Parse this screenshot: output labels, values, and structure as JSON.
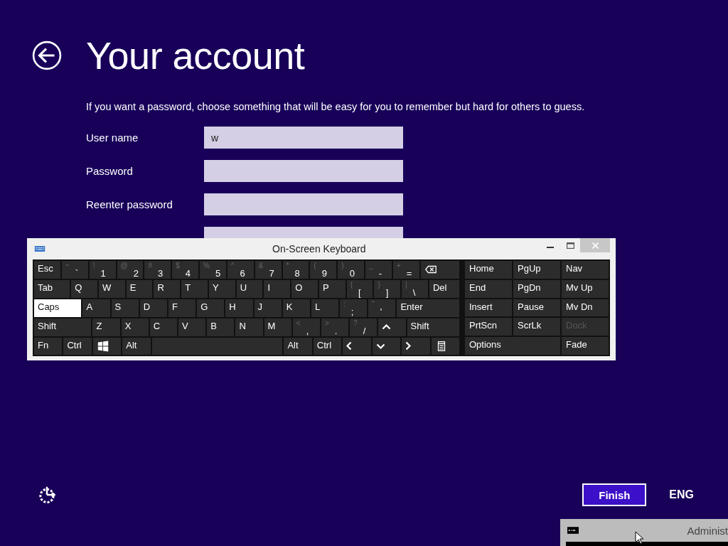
{
  "header": {
    "title": "Your account"
  },
  "intro": "If you want a password, choose something that will be easy for you to remember but hard for others to guess.",
  "fields": [
    {
      "kind": "field",
      "label": "User name",
      "value": "w"
    },
    {
      "kind": "field",
      "label": "Password"
    },
    {
      "kind": "field",
      "label": "Reenter password"
    },
    {
      "kind": "field"
    }
  ],
  "keyboard": {
    "title": "On-Screen Keyboard",
    "rows": [
      {
        "keys": [
          {
            "label": "Esc",
            "kind": "key",
            "on": false
          },
          {
            "label": "`",
            "shift": "~",
            "kind": "key",
            "on": false
          },
          {
            "label": "1",
            "shift": "!",
            "kind": "key",
            "on": false
          },
          {
            "label": "2",
            "shift": "@",
            "kind": "key",
            "on": false
          },
          {
            "label": "3",
            "shift": "#",
            "kind": "key",
            "on": false
          },
          {
            "label": "4",
            "shift": "$",
            "kind": "key",
            "on": false
          },
          {
            "label": "5",
            "shift": "%",
            "kind": "key",
            "on": false
          },
          {
            "label": "6",
            "shift": "^",
            "kind": "key",
            "on": false
          },
          {
            "label": "7",
            "shift": "&",
            "kind": "key",
            "on": false
          },
          {
            "label": "8",
            "shift": "*",
            "kind": "key",
            "on": false
          },
          {
            "label": "9",
            "shift": "(",
            "kind": "key",
            "on": false
          },
          {
            "label": "0",
            "shift": ")",
            "kind": "key",
            "on": false
          },
          {
            "label": "-",
            "shift": "_",
            "kind": "key",
            "on": false
          },
          {
            "label": "=",
            "shift": "+",
            "kind": "key",
            "on": false
          },
          {
            "kind": "backspace",
            "on": false
          }
        ]
      },
      {
        "keys": [
          {
            "label": "Tab",
            "kind": "tab",
            "on": false
          },
          {
            "label": "Q",
            "kind": "key",
            "on": false
          },
          {
            "label": "W",
            "kind": "key",
            "on": false
          },
          {
            "label": "E",
            "kind": "key",
            "on": false
          },
          {
            "label": "R",
            "kind": "key",
            "on": false
          },
          {
            "label": "T",
            "kind": "key",
            "on": false
          },
          {
            "label": "Y",
            "kind": "key",
            "on": false
          },
          {
            "label": "U",
            "kind": "key",
            "on": false
          },
          {
            "label": "I",
            "kind": "key",
            "on": false
          },
          {
            "label": "O",
            "kind": "key",
            "on": false
          },
          {
            "label": "P",
            "kind": "key",
            "on": false
          },
          {
            "label": "[",
            "shift": "{",
            "kind": "key",
            "on": false
          },
          {
            "label": "]",
            "shift": "}",
            "kind": "key",
            "on": false
          },
          {
            "label": "\\",
            "shift": "|",
            "kind": "key",
            "on": false
          },
          {
            "label": "Del",
            "kind": "del",
            "on": false
          }
        ]
      },
      {
        "keys": [
          {
            "label": "Caps",
            "kind": "caps",
            "on": true
          },
          {
            "label": "A",
            "kind": "key",
            "on": false
          },
          {
            "label": "S",
            "kind": "key",
            "on": false
          },
          {
            "label": "D",
            "kind": "key",
            "on": false
          },
          {
            "label": "F",
            "kind": "key",
            "on": false
          },
          {
            "label": "G",
            "kind": "key",
            "on": false
          },
          {
            "label": "H",
            "kind": "key",
            "on": false
          },
          {
            "label": "J",
            "kind": "key",
            "on": false
          },
          {
            "label": "K",
            "kind": "key",
            "on": false
          },
          {
            "label": "L",
            "kind": "key",
            "on": false
          },
          {
            "label": ";",
            "shift": ":",
            "kind": "key",
            "on": false
          },
          {
            "label": "'",
            "shift": "\"",
            "kind": "key",
            "on": false
          },
          {
            "label": "Enter",
            "kind": "enter",
            "on": false
          }
        ]
      },
      {
        "keys": [
          {
            "label": "Shift",
            "kind": "shift",
            "on": false
          },
          {
            "label": "Z",
            "kind": "key",
            "on": false
          },
          {
            "label": "X",
            "kind": "key",
            "on": false
          },
          {
            "label": "C",
            "kind": "key",
            "on": false
          },
          {
            "label": "V",
            "kind": "key",
            "on": false
          },
          {
            "label": "B",
            "kind": "key",
            "on": false
          },
          {
            "label": "N",
            "kind": "key",
            "on": false
          },
          {
            "label": "M",
            "kind": "key",
            "on": false
          },
          {
            "label": ",",
            "shift": "<",
            "kind": "key",
            "on": false
          },
          {
            "label": ".",
            "shift": ">",
            "kind": "key",
            "on": false
          },
          {
            "label": "/",
            "shift": "?",
            "kind": "key",
            "on": false
          },
          {
            "kind": "up",
            "on": false
          },
          {
            "label": "Shift",
            "kind": "rshift",
            "on": false
          }
        ]
      },
      {
        "keys": [
          {
            "label": "Fn",
            "kind": "key",
            "on": false
          },
          {
            "label": "Ctrl",
            "kind": "key",
            "on": false
          },
          {
            "kind": "win",
            "on": false
          },
          {
            "label": "Alt",
            "kind": "key",
            "on": false
          },
          {
            "kind": "space",
            "on": false
          },
          {
            "label": "Alt",
            "kind": "key",
            "on": false
          },
          {
            "label": "Ctrl",
            "kind": "key",
            "on": false
          },
          {
            "kind": "left",
            "on": false
          },
          {
            "kind": "down",
            "on": false
          },
          {
            "kind": "right",
            "on": false
          },
          {
            "kind": "menu",
            "on": false
          }
        ]
      }
    ],
    "nav_keys": [
      {
        "label": "Home",
        "kind": "key",
        "disabled": false
      },
      {
        "label": "PgUp",
        "kind": "key",
        "disabled": false
      },
      {
        "label": "Nav",
        "kind": "key",
        "disabled": false
      },
      {
        "label": "End",
        "kind": "key",
        "disabled": false
      },
      {
        "label": "PgDn",
        "kind": "key",
        "disabled": false
      },
      {
        "label": "Mv Up",
        "kind": "key",
        "disabled": false
      },
      {
        "label": "Insert",
        "kind": "key",
        "disabled": false
      },
      {
        "label": "Pause",
        "kind": "key",
        "disabled": false
      },
      {
        "label": "Mv Dn",
        "kind": "key",
        "disabled": false
      },
      {
        "label": "PrtScn",
        "kind": "key",
        "disabled": false
      },
      {
        "label": "ScrLk",
        "kind": "key",
        "disabled": false
      },
      {
        "label": "Dock",
        "kind": "key",
        "disabled": true
      },
      {
        "label": "Options",
        "kind": "wide",
        "disabled": false
      },
      {
        "label": "Fade",
        "kind": "key",
        "disabled": false
      }
    ]
  },
  "footer": {
    "button": "Finish",
    "language": "ENG"
  },
  "console_window": {
    "title": "Administ"
  }
}
